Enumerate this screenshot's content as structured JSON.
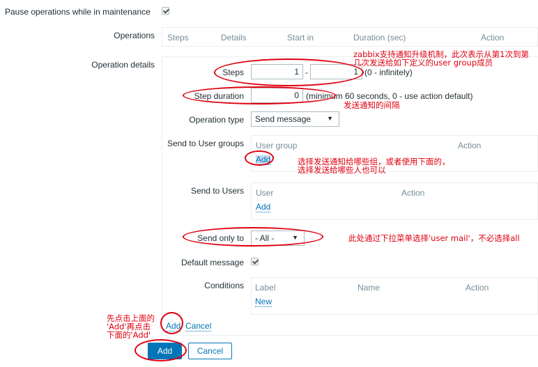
{
  "form": {
    "pause_label": "Pause operations while in maintenance",
    "pause_checked": true,
    "operations": {
      "label": "Operations",
      "columns": [
        "Steps",
        "Details",
        "Start in",
        "Duration (sec)",
        "Action"
      ]
    },
    "operation_details": {
      "label": "Operation details",
      "steps": {
        "label": "Steps",
        "from_value": "1",
        "separator": "-",
        "to_value": "1",
        "hint": "(0 - infinitely)"
      },
      "step_duration": {
        "label": "Step duration",
        "value": "0",
        "hint": "(minimum 60 seconds, 0 - use action default)"
      },
      "operation_type": {
        "label": "Operation type",
        "selected": "Send message"
      },
      "send_to_user_groups": {
        "label": "Send to User groups",
        "columns": [
          "User group",
          "Action"
        ],
        "add_label": "Add"
      },
      "send_to_users": {
        "label": "Send to Users",
        "columns": [
          "User",
          "Action"
        ],
        "add_label": "Add"
      },
      "send_only_to": {
        "label": "Send only to",
        "selected": "- All -"
      },
      "default_message": {
        "label": "Default message",
        "checked": true
      },
      "conditions": {
        "label": "Conditions",
        "columns": [
          "Label",
          "Name",
          "Action"
        ],
        "new_label": "New"
      },
      "add_link": "Add",
      "cancel_link": "Cancel"
    },
    "add_button": "Add",
    "cancel_button": "Cancel"
  },
  "annotations": {
    "steps_note_line1": "zabbix支持通知升级机制，此次表示从第1次到第",
    "steps_note_line2": "几次发送给如下定义的user group成员",
    "duration_note": "发送通知的间隔",
    "groups_note_line1": "选择发送通知给哪些组，或者使用下面的，",
    "groups_note_line2": "选择发送给哪些人也可以",
    "send_only_note": "此处通过下拉菜单选择'user mail'，不必选择all",
    "add_note_line1": "先点击上面的",
    "add_note_line2": "'Add'再点击",
    "add_note_line3": "下面的'Add'"
  },
  "colors": {
    "accent": "#0275b8",
    "annotation": "#e0000f",
    "border": "#ebeef0",
    "header_text": "#768d99"
  }
}
